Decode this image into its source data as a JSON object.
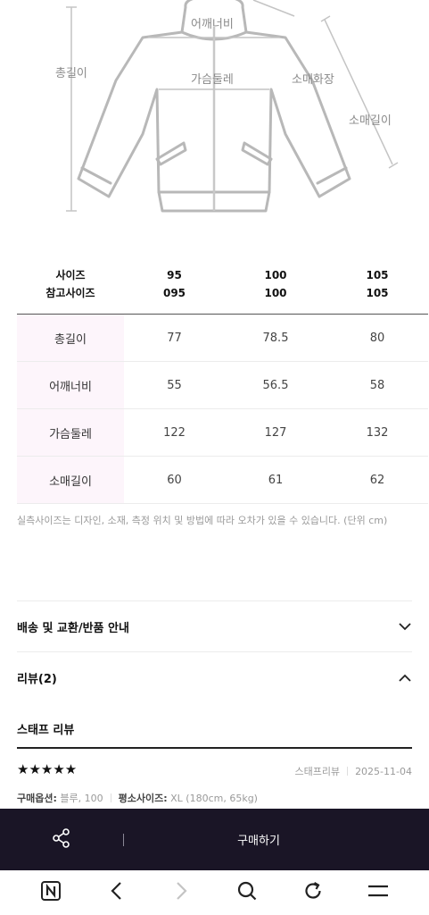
{
  "diagram": {
    "labels": {
      "total_length": "총길이",
      "shoulder_width": "어깨너비",
      "chest": "가슴둘레",
      "sleeve_hwajang": "소매화장",
      "sleeve_length": "소매길이"
    }
  },
  "size_table": {
    "header": {
      "label_line1": "사이즈",
      "label_line2": "참고사이즈",
      "sizes": [
        {
          "line1": "95",
          "line2": "095"
        },
        {
          "line1": "100",
          "line2": "100"
        },
        {
          "line1": "105",
          "line2": "105"
        }
      ]
    },
    "rows": [
      {
        "label": "총길이",
        "values": [
          "77",
          "78.5",
          "80"
        ]
      },
      {
        "label": "어깨너비",
        "values": [
          "55",
          "56.5",
          "58"
        ]
      },
      {
        "label": "가슴둘레",
        "values": [
          "122",
          "127",
          "132"
        ]
      },
      {
        "label": "소매길이",
        "values": [
          "60",
          "61",
          "62"
        ]
      }
    ],
    "note": "실측사이즈는 디자인, 소재, 측정 위치 및 방법에 따라 오차가 있을 수 있습니다. (단위 cm)"
  },
  "accordions": {
    "shipping": {
      "title": "배송 및 교환/반품 안내",
      "state": "collapsed"
    },
    "reviews": {
      "title": "리뷰(2)",
      "state": "expanded"
    }
  },
  "review": {
    "section_title": "스태프 리뷰",
    "stars": "★★★★★",
    "author": "스태프리뷰",
    "date": "2025-11-04",
    "option_label": "구매옵션:",
    "option_value": "블루, 100",
    "size_label": "평소사이즈:",
    "size_value": "XL (180cm, 65kg)"
  },
  "buy_bar": {
    "buy_label": "구매하기",
    "share_icon": "share-icon"
  },
  "browser_nav": {
    "icons": [
      "naver-icon",
      "back-icon",
      "forward-icon",
      "search-icon",
      "refresh-icon",
      "menu-icon"
    ]
  },
  "colors": {
    "bar_bg": "#1a1526",
    "label_cell_bg": "#fdf5fb",
    "diagram_stroke": "#bbbbbb"
  }
}
